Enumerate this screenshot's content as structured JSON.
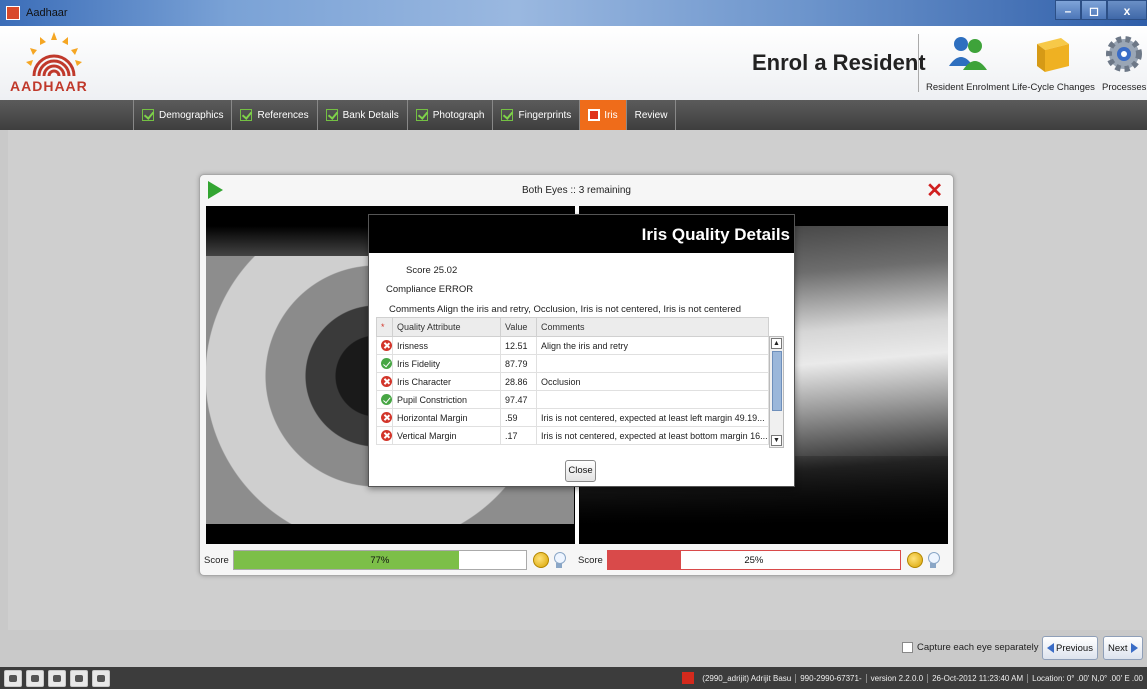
{
  "window": {
    "title": "Aadhaar",
    "min": "–",
    "max": "◻",
    "close": "x"
  },
  "header": {
    "logo_text": "AADHAAR",
    "page_title": "Enrol a Resident",
    "tools": [
      {
        "label": "Resident Enrolment"
      },
      {
        "label": "Life-Cycle Changes"
      },
      {
        "label": "Processes"
      }
    ]
  },
  "tabs": [
    {
      "label": "Demographics",
      "state": "done"
    },
    {
      "label": "References",
      "state": "done"
    },
    {
      "label": "Bank Details",
      "state": "done"
    },
    {
      "label": "Photograph",
      "state": "done"
    },
    {
      "label": "Fingerprints",
      "state": "done"
    },
    {
      "label": "Iris",
      "state": "active"
    },
    {
      "label": "Review",
      "state": "pending"
    }
  ],
  "capture": {
    "title": "Both Eyes :: 3 remaining",
    "left_score_label": "Score",
    "left_score_value": "77%",
    "left_score_fraction": 0.77,
    "right_score_label": "Score",
    "right_score_value": "25%",
    "right_score_fraction": 0.25,
    "colors": {
      "good": "#7cbf48",
      "bad": "#d94a4a"
    }
  },
  "quality_dialog": {
    "title": "Iris Quality Details",
    "score": "Score 25.02",
    "compliance": "Compliance ERROR",
    "comments": "Comments  Align the iris and retry, Occlusion, Iris is not centered, Iris is not centered",
    "columns": [
      "*",
      "Quality Attribute",
      "Value",
      "Comments"
    ],
    "rows": [
      {
        "status": "error",
        "attribute": "Irisness",
        "value": "12.51",
        "comment": "Align the iris and retry"
      },
      {
        "status": "ok",
        "attribute": "Iris Fidelity",
        "value": "87.79",
        "comment": ""
      },
      {
        "status": "error",
        "attribute": "Iris Character",
        "value": "28.86",
        "comment": "Occlusion"
      },
      {
        "status": "ok",
        "attribute": "Pupil Constriction",
        "value": "97.47",
        "comment": ""
      },
      {
        "status": "error",
        "attribute": "Horizontal Margin",
        "value": ".59",
        "comment": "Iris is not centered, expected at least left margin 49.19..."
      },
      {
        "status": "error",
        "attribute": "Vertical Margin",
        "value": ".17",
        "comment": "Iris is not centered, expected at least bottom margin 16..."
      }
    ],
    "close_label": "Close"
  },
  "footer": {
    "capture_separately": "Capture each eye separately",
    "previous": "Previous",
    "next": "Next"
  },
  "statusbar": {
    "user": "(2990_adrijit) Adrijit Basu",
    "station": "990-2990-67371-",
    "version": "version 2.2.0.0",
    "datetime": "26-Oct-2012 11:23:40 AM",
    "location": "Location: 0° .00' N,0° .00' E .00"
  }
}
